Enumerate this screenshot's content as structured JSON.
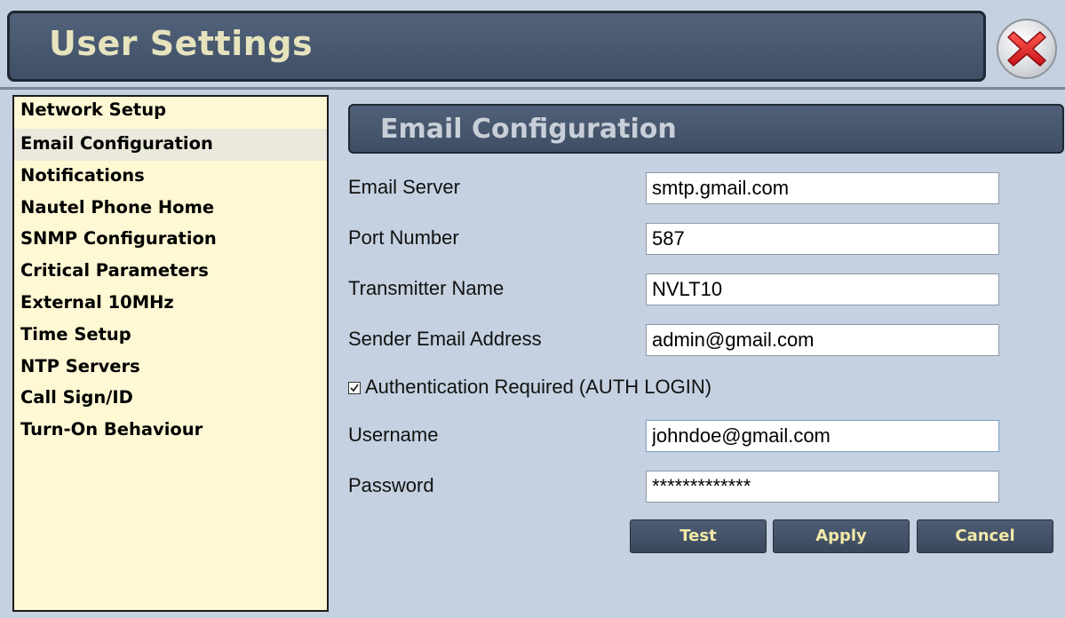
{
  "window": {
    "title": "User Settings"
  },
  "sidebar": {
    "items": [
      {
        "label": "Network Setup"
      },
      {
        "label": "Email Configuration",
        "selected": true
      },
      {
        "label": "Notifications"
      },
      {
        "label": "Nautel Phone Home"
      },
      {
        "label": "SNMP Configuration"
      },
      {
        "label": "Critical Parameters"
      },
      {
        "label": "External 10MHz"
      },
      {
        "label": "Time Setup"
      },
      {
        "label": "NTP Servers"
      },
      {
        "label": "Call Sign/ID"
      },
      {
        "label": "Turn-On Behaviour"
      }
    ]
  },
  "main": {
    "section_title": "Email Configuration",
    "fields": {
      "email_server": {
        "label": "Email Server",
        "value": "smtp.gmail.com"
      },
      "port_number": {
        "label": "Port Number",
        "value": "587"
      },
      "transmitter_name": {
        "label": "Transmitter Name",
        "value": "NVLT10"
      },
      "sender_email": {
        "label": "Sender Email Address",
        "value": "admin@gmail.com"
      },
      "username": {
        "label": "Username",
        "value": "johndoe@gmail.com"
      },
      "password": {
        "label": "Password",
        "value": "*************"
      }
    },
    "auth_checkbox": {
      "label": "Authentication Required (AUTH LOGIN)",
      "checked": true
    },
    "buttons": {
      "test": "Test",
      "apply": "Apply",
      "cancel": "Cancel"
    }
  },
  "colors": {
    "background": "#c5d1e0",
    "title_bar": "#46566d",
    "title_text": "#e6e3bd",
    "sidebar_bg": "#fff8d4",
    "selected_item_bg": "#ebe8dc",
    "button_text": "#f2e9a8",
    "close_icon": "#e0242a"
  }
}
